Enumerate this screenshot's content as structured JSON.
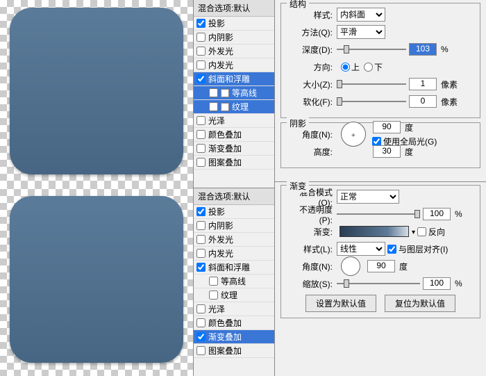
{
  "mid": {
    "header": "混合选项:默认",
    "items_top": [
      {
        "label": "投影",
        "checked": true,
        "selected": false
      },
      {
        "label": "内阴影",
        "checked": false,
        "selected": false
      },
      {
        "label": "外发光",
        "checked": false,
        "selected": false
      },
      {
        "label": "内发光",
        "checked": false,
        "selected": false
      },
      {
        "label": "斜面和浮雕",
        "checked": true,
        "selected": true
      },
      {
        "label": "等高线",
        "checked": false,
        "selected": true,
        "sub": true,
        "icon": true
      },
      {
        "label": "纹理",
        "checked": false,
        "selected": true,
        "sub": true,
        "icon": true
      },
      {
        "label": "光泽",
        "checked": false,
        "selected": false
      },
      {
        "label": "颜色叠加",
        "checked": false,
        "selected": false
      },
      {
        "label": "渐变叠加",
        "checked": false,
        "selected": false
      },
      {
        "label": "图案叠加",
        "checked": false,
        "selected": false
      }
    ],
    "items_bottom": [
      {
        "label": "投影",
        "checked": true,
        "selected": false
      },
      {
        "label": "内阴影",
        "checked": false,
        "selected": false
      },
      {
        "label": "外发光",
        "checked": false,
        "selected": false
      },
      {
        "label": "内发光",
        "checked": false,
        "selected": false
      },
      {
        "label": "斜面和浮雕",
        "checked": true,
        "selected": false
      },
      {
        "label": "等高线",
        "checked": false,
        "selected": false,
        "sub": true
      },
      {
        "label": "纹理",
        "checked": false,
        "selected": false,
        "sub": true
      },
      {
        "label": "光泽",
        "checked": false,
        "selected": false
      },
      {
        "label": "颜色叠加",
        "checked": false,
        "selected": false
      },
      {
        "label": "渐变叠加",
        "checked": true,
        "selected": true
      },
      {
        "label": "图案叠加",
        "checked": false,
        "selected": false
      }
    ]
  },
  "bevel": {
    "group_structure": "结构",
    "style_label": "样式:",
    "style_value": "内斜面",
    "method_label": "方法(Q):",
    "method_value": "平滑",
    "depth_label": "深度(D):",
    "depth_value": "103",
    "depth_unit": "%",
    "direction_label": "方向:",
    "up": "上",
    "down": "下",
    "size_label": "大小(Z):",
    "size_value": "1",
    "size_unit": "像素",
    "soften_label": "软化(F):",
    "soften_value": "0",
    "soften_unit": "像素",
    "group_shadow": "阴影",
    "angle_label": "角度(N):",
    "angle_value": "90",
    "angle_unit": "度",
    "global_label": "使用全局光(G)",
    "altitude_label": "高度:",
    "altitude_value": "30",
    "altitude_unit": "度"
  },
  "grad": {
    "group": "渐变",
    "blend_label": "混合模式(O):",
    "blend_value": "正常",
    "opacity_label": "不透明度(P):",
    "opacity_value": "100",
    "opacity_unit": "%",
    "gradient_label": "渐变:",
    "reverse_label": "反向",
    "style_label": "样式(L):",
    "style_value": "线性",
    "align_label": "与图层对齐(I)",
    "angle_label": "角度(N):",
    "angle_value": "90",
    "angle_unit": "度",
    "scale_label": "缩放(S):",
    "scale_value": "100",
    "scale_unit": "%",
    "btn_default": "设置为默认值",
    "btn_reset": "复位为默认值"
  }
}
